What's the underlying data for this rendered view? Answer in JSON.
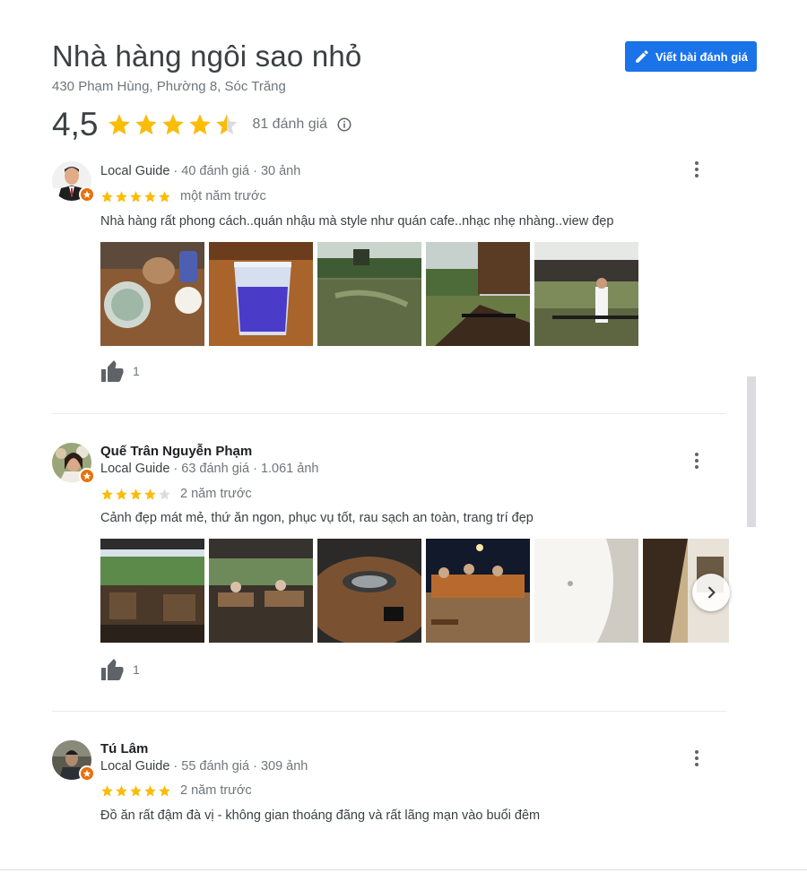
{
  "place": {
    "title": "Nhà hàng ngôi sao nhỏ",
    "address": "430 Phạm Hùng, Phường 8, Sóc Trăng",
    "rating": "4,5",
    "rating_value": 4.5,
    "review_count": "81 đánh giá",
    "write_review_label": "Viết bài đánh giá"
  },
  "colors": {
    "accent": "#1a73e8",
    "star": "#fbbc04",
    "star_empty": "#dadce0",
    "badge": "#e8710a"
  },
  "reviews": [
    {
      "name": "",
      "guide": "Local Guide",
      "stats": " · 40 đánh giá · 30 ảnh",
      "stars": 5,
      "time": "một năm trước",
      "text": "Nhà hàng rất phong cách..quán nhậu mà style như quán cafe..nhạc nhẹ nhàng..view đẹp",
      "likes": "1"
    },
    {
      "name": "Quế Trân Nguyễn Phạm",
      "guide": "Local Guide",
      "stats": " · 63 đánh giá · 1.061 ảnh",
      "stars": 4,
      "time": "2 năm trước",
      "text": "Cảnh đẹp mát mẻ, thứ ăn ngon, phục vụ tốt, rau sạch an toàn, trang trí đẹp",
      "likes": "1"
    },
    {
      "name": "Tú Lâm",
      "guide": "Local Guide",
      "stats": " · 55 đánh giá · 309 ảnh",
      "stars": 5,
      "time": "2 năm trước",
      "text": "Đồ ăn rất đậm đà vị - không gian thoáng đãng và rất lãng mạn vào buổi đêm",
      "likes": ""
    }
  ],
  "icons": {
    "edit": "pencil-icon",
    "info": "info-icon",
    "like": "thumbs-up-icon",
    "more": "more-vert-icon",
    "next": "chevron-right-icon",
    "badge": "local-guide-star-icon"
  }
}
